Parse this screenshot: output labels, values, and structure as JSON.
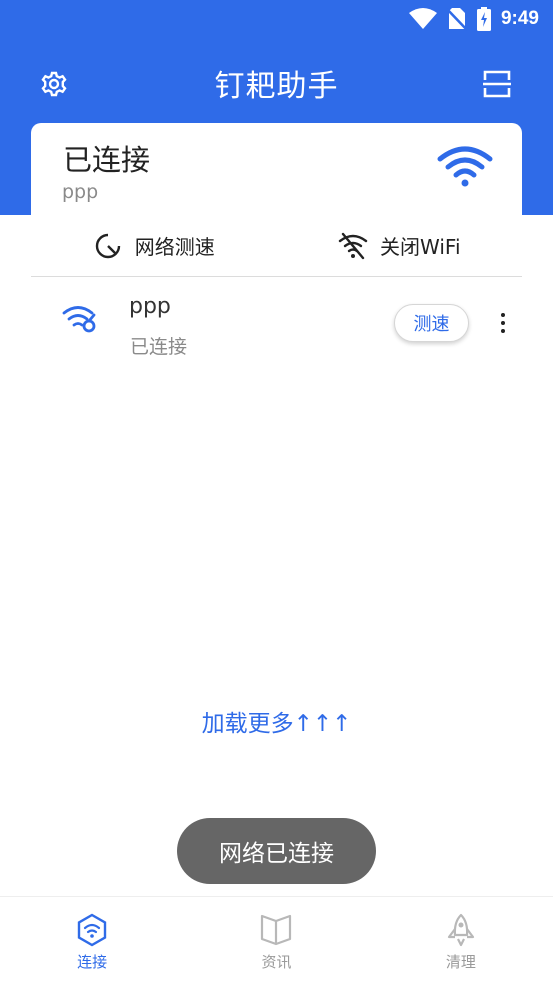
{
  "status_bar": {
    "time": "9:49"
  },
  "app_bar": {
    "title": "钉耙助手"
  },
  "connection": {
    "status": "已连接",
    "ssid": "ppp"
  },
  "actions": {
    "speed_test": "网络测速",
    "close_wifi": "关闭WiFi"
  },
  "wifi_list": [
    {
      "ssid": "ppp",
      "status": "已连接",
      "button": "测速"
    }
  ],
  "load_more": "加载更多↑↑↑",
  "toast": "网络已连接",
  "bottom_nav": [
    {
      "label": "连接",
      "active": true
    },
    {
      "label": "资讯",
      "active": false
    },
    {
      "label": "清理",
      "active": false
    }
  ],
  "colors": {
    "primary": "#2f6be8",
    "toast_bg": "#666666",
    "inactive": "#9a9a9a"
  }
}
